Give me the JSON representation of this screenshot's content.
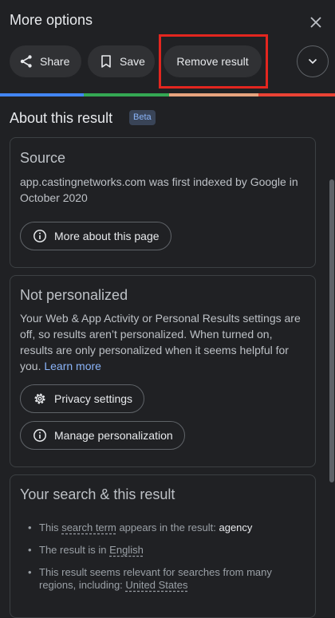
{
  "header": {
    "title": "More options",
    "share_label": "Share",
    "save_label": "Save",
    "remove_label": "Remove result"
  },
  "about": {
    "title": "About this result",
    "beta": "Beta"
  },
  "source": {
    "title": "Source",
    "text": "app.castingnetworks.com was first indexed by Google in October 2020",
    "button": "More about this page"
  },
  "personal": {
    "title": "Not personalized",
    "text": "Your Web & App Activity or Personal Results settings are off, so results aren’t personalized. When turned on, results are only personalized when it seems helpful for you.",
    "link": "Learn more",
    "privacy_button": "Privacy settings",
    "manage_button": "Manage personalization"
  },
  "search": {
    "title": "Your search & this result",
    "b1_pre": "This",
    "b1_term": "search term",
    "b1_mid": "appears in the result:",
    "b1_val": "agency",
    "b2_pre": "The result is in",
    "b2_lang": "English",
    "b3_pre": "This result seems relevant for searches from many regions, including:",
    "b3_val": "United States"
  }
}
